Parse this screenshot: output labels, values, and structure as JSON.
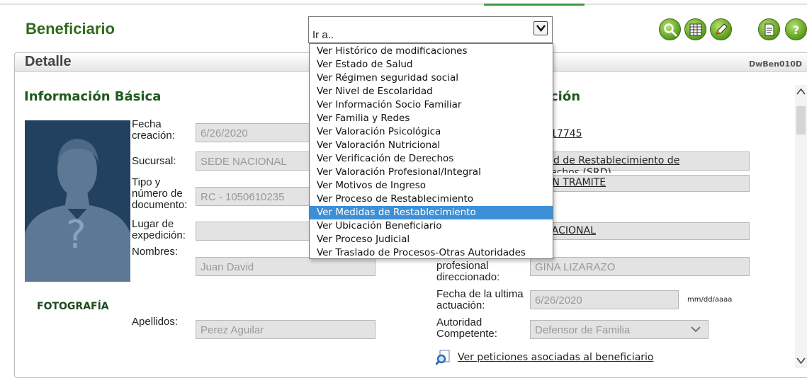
{
  "header": {
    "title": "Beneficiario",
    "goto_select": {
      "value": "Ir a..",
      "options": [
        "Ver Histórico de modificaciones",
        "Ver Estado de Salud",
        "Ver Régimen seguridad social",
        "Ver Nivel de Escolaridad",
        "Ver Información Socio Familiar",
        "Ver Familia y Redes",
        "Ver Valoración Psicológica",
        "Ver Valoración Nutricional",
        "Ver Verificación de Derechos",
        "Ver Valoración Profesional/Integral",
        "Ver Motivos de Ingreso",
        "Ver Proceso de Restablecimiento",
        "Ver Medidas de Restablecimiento",
        "Ver Ubicación Beneficiario",
        "Ver Proceso Judicial",
        "Ver Traslado de Procesos-Otras Autoridades"
      ],
      "highlighted_index": 12
    },
    "toolbar_icons": [
      "search-icon",
      "grid-icon",
      "edit-icon",
      "document-icon",
      "help-icon"
    ],
    "accent_color": "#5a9a1c"
  },
  "panel": {
    "title": "Detalle",
    "code": "DwBen010D"
  },
  "basic_info": {
    "title": "Información Básica",
    "photo_label": "FOTOGRAFÍA",
    "fields": {
      "fecha_creacion": {
        "label": "Fecha creación:",
        "value": "6/26/2020"
      },
      "sucursal": {
        "label": "Sucursal:",
        "value": "SEDE NACIONAL"
      },
      "documento": {
        "label": "Tipo y número de documento:",
        "value": "RC    - 1050610235"
      },
      "lugar_expedicion": {
        "label": "Lugar de expedición:",
        "value": ""
      },
      "nombres": {
        "label": "Nombres:",
        "value": "Juan  David"
      },
      "apellidos": {
        "label": "Apellidos:",
        "value": "Perez Aguilar"
      }
    }
  },
  "right_section": {
    "title_visible": "ción",
    "numero": "17745",
    "solicitud_line1": "citud de Restablecimiento de",
    "solicitud_line2": "echos (SRD)",
    "estado": "O EN TRAMITE",
    "sede": "E NACIONAL",
    "profesional": {
      "label": "profesional direccionado:",
      "value": "GINA LIZARAZO"
    },
    "fecha_ultima": {
      "label": "Fecha de la ultima actuación:",
      "value": "6/26/2020",
      "hint": "mm/dd/aaaa"
    },
    "autoridad": {
      "label": "Autoridad Competente:",
      "value": "Defensor de Familia"
    },
    "peticiones_link": "Ver peticiones asociadas al beneficiario"
  }
}
